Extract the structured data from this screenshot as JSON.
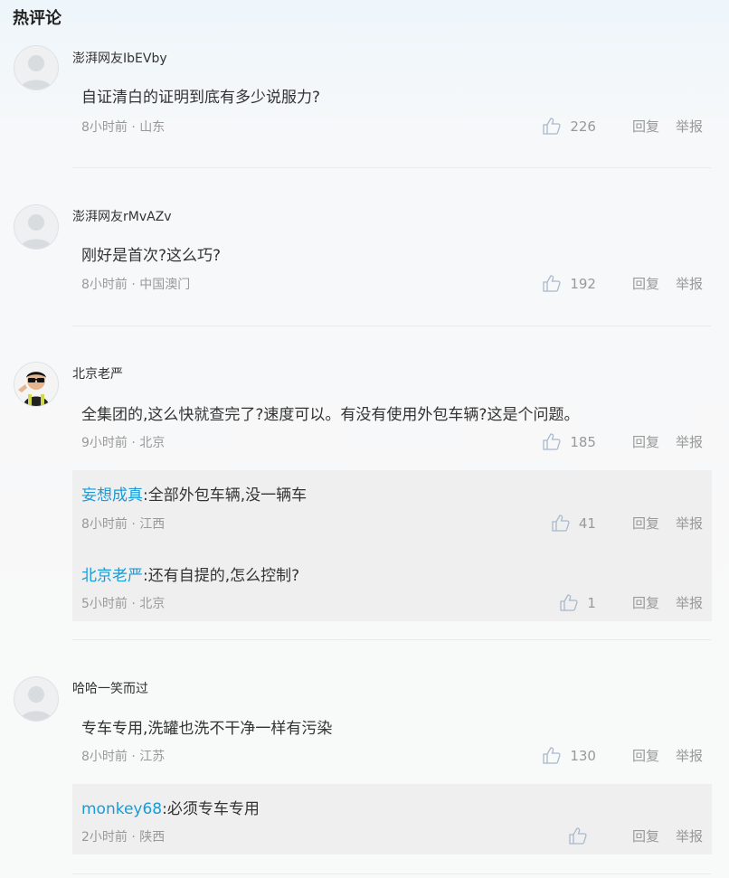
{
  "section_title": "热评论",
  "comments": [
    {
      "username": "澎湃网友IbEVby",
      "text": "自证清白的证明到底有多少说服力?",
      "time_location": "8小时前 · 山东",
      "likes": "226",
      "reply_label": "回复",
      "report_label": "举报",
      "avatar": "default-avatar"
    },
    {
      "username": "澎湃网友rMvAZv",
      "text": "刚好是首次?这么巧?",
      "time_location": "8小时前 · 中国澳门",
      "likes": "192",
      "reply_label": "回复",
      "report_label": "举报",
      "avatar": "default-avatar"
    },
    {
      "username": "北京老严",
      "text": "全集团的,这么快就查完了?速度可以。有没有使用外包车辆?这是个问题。",
      "time_location": "9小时前 · 北京",
      "likes": "185",
      "reply_label": "回复",
      "report_label": "举报",
      "avatar": "custom-avatar",
      "replies": [
        {
          "username": "妄想成真",
          "separator": ":",
          "text": "全部外包车辆,没一辆车",
          "time_location": "8小时前 · 江西",
          "likes": "41",
          "reply_label": "回复",
          "report_label": "举报"
        },
        {
          "username": "北京老严",
          "separator": ":",
          "text": "还有自提的,怎么控制?",
          "time_location": "5小时前 · 北京",
          "likes": "1",
          "reply_label": "回复",
          "report_label": "举报"
        }
      ]
    },
    {
      "username": "哈哈一笑而过",
      "text": "专车专用,洗罐也洗不干净一样有污染",
      "time_location": "8小时前 · 江苏",
      "likes": "130",
      "reply_label": "回复",
      "report_label": "举报",
      "avatar": "default-avatar",
      "replies": [
        {
          "username": "monkey68",
          "separator": ":",
          "text": "必须专车专用",
          "time_location": "2小时前 · 陕西",
          "likes": "",
          "reply_label": "回复",
          "report_label": "举报"
        }
      ]
    }
  ],
  "colors": {
    "link": "#1a9ad6",
    "meta": "#999999",
    "reply_bg": "#efefef"
  }
}
